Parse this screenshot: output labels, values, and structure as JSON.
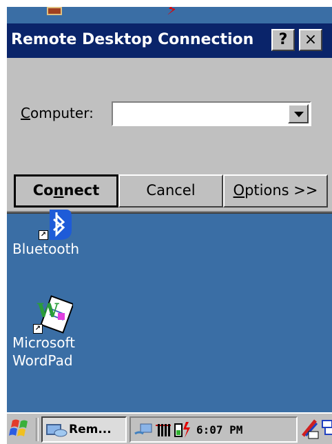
{
  "desktop": {
    "background": "#3a6ea5",
    "icons": [
      {
        "label": "Bluetooth",
        "icon": "bluetooth-icon"
      },
      {
        "label": "Microsoft\nWordPad",
        "icon": "wordpad-icon"
      }
    ]
  },
  "dialog": {
    "title": "Remote Desktop Connection",
    "help_label": "?",
    "close_label": "×",
    "computer_label_prefix": "C",
    "computer_label_rest": "omputer:",
    "computer_value": "",
    "connect_prefix": "Co",
    "connect_ul": "n",
    "connect_rest": "nect",
    "cancel_label": "Cancel",
    "options_ul": "O",
    "options_rest": "ptions >>"
  },
  "taskbar": {
    "start_icon": "windows-flag-icon",
    "task_label": "Rem...",
    "clock": "6:07 PM",
    "tray_icons": [
      "network-icon",
      "signal-icon",
      "battery-charging-icon",
      "input-panel-icon",
      "desktop-icon"
    ]
  },
  "colors": {
    "titlebar": "#0a246a",
    "dialog": "#c0c0c0",
    "text_on_title": "#ffffff"
  }
}
